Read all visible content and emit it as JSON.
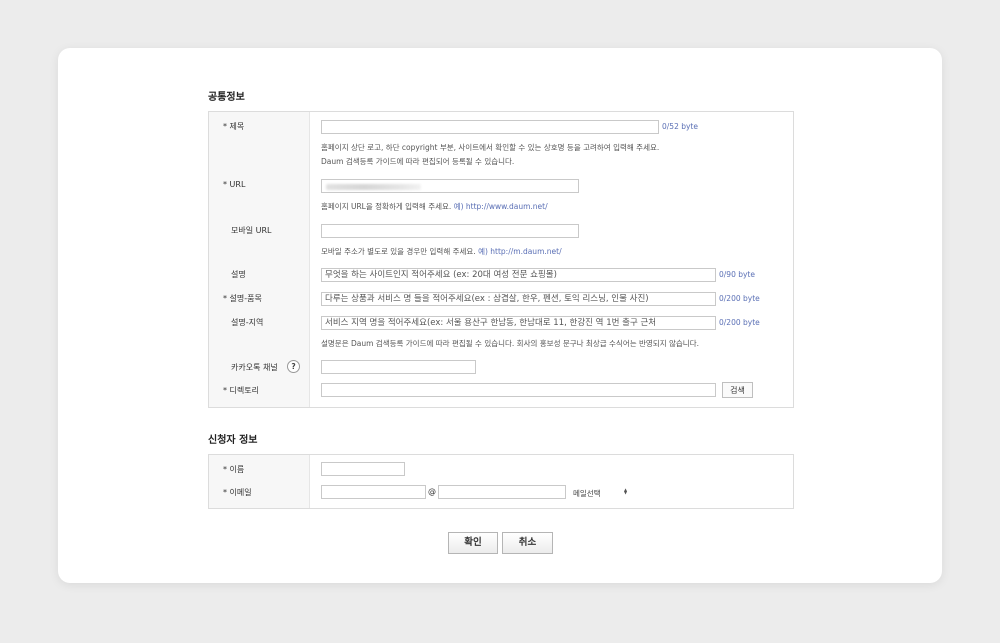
{
  "sections": {
    "common": {
      "title": "공통정보",
      "title_field": {
        "label": "* 제목",
        "value": "",
        "count": "0/52 byte",
        "help1": "홈페이지 상단 로고, 하단 copyright 부분, 사이트에서 확인할 수 있는 상호명 등을 고려하여 입력해 주세요.",
        "help2": "Daum 검색등록 가이드에 따라 편집되어 등록될 수 있습니다."
      },
      "url_field": {
        "label": "* URL",
        "help": "홈페이지 URL을 정확하게 입력해 주세요.",
        "example": "예) http://www.daum.net/"
      },
      "mobile_url_field": {
        "label": "모바일 URL",
        "value": "",
        "help": "모바일 주소가 별도로 있을 경우만 입력해 주세요.",
        "example": "예) http://m.daum.net/"
      },
      "desc_field": {
        "label": "설명",
        "value": "무엇을 하는 사이트인지 적어주세요 (ex: 20대 여성 전문 쇼핑몰)",
        "count": "0/90 byte"
      },
      "desc_item_field": {
        "label": "* 설명-품목",
        "value": "다루는 상품과 서비스 명 들을 적어주세요(ex : 삼겹살, 한우, 펜션, 토익 리스닝, 인물 사진)",
        "count": "0/200 byte"
      },
      "desc_region_field": {
        "label": "설명-지역",
        "value": "서비스 지역 명을 적어주세요(ex: 서울  용산구 한남동, 한남대로 11, 한강진 역 1번 출구 근처",
        "count": "0/200 byte",
        "help": "설명문은 Daum 검색등록 가이드에 따라 편집될 수 있습니다. 회사의 홍보성 문구나 최상급 수식어는 반영되지 않습니다."
      },
      "kakao_field": {
        "label": "카카오톡 채널",
        "help_icon": "?",
        "value": ""
      },
      "directory_field": {
        "label": "* 디렉토리",
        "value": "",
        "search_button": "검색"
      }
    },
    "applicant": {
      "title": "신청자 정보",
      "name_field": {
        "label": "* 이름",
        "value": ""
      },
      "email_field": {
        "label": "* 이메일",
        "local": "",
        "at": "@",
        "domain": "",
        "select_value": "메일선택",
        "select_arrow": "▲▼"
      }
    }
  },
  "buttons": {
    "confirm": "확인",
    "cancel": "취소"
  },
  "colors": {
    "background": "#ececec",
    "card": "#ffffff",
    "label_column": "#f7f7f7",
    "accent_link": "#5a6fb5",
    "border": "#dcdcdc"
  }
}
